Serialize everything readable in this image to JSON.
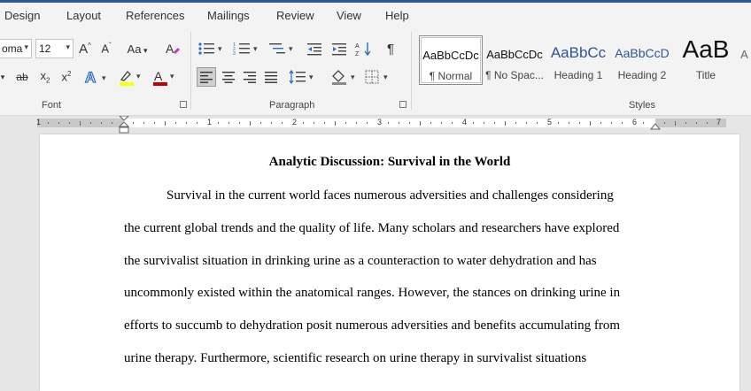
{
  "tabs": [
    "Design",
    "Layout",
    "References",
    "Mailings",
    "Review",
    "View",
    "Help"
  ],
  "font": {
    "name_value": "oma",
    "size_value": "12",
    "group_label": "Font",
    "highlight_color": "#ffff00",
    "font_color": "#c00000"
  },
  "paragraph": {
    "group_label": "Paragraph"
  },
  "styles": {
    "group_label": "Styles",
    "items": [
      {
        "sample": "AaBbCcDc",
        "name": "¶ Normal"
      },
      {
        "sample": "AaBbCcDc",
        "name": "¶ No Spac..."
      },
      {
        "sample": "AaBbCc",
        "name": "Heading 1"
      },
      {
        "sample": "AaBbCcD",
        "name": "Heading 2"
      },
      {
        "sample": "AaB",
        "name": "Title"
      },
      {
        "sample": "A",
        "name": ""
      }
    ]
  },
  "ruler": {
    "numbers": [
      "1",
      "1",
      "2",
      "3",
      "4",
      "5",
      "6",
      "7"
    ]
  },
  "document": {
    "title": "Analytic Discussion: Survival in the World",
    "lines": [
      "Survival in the current world faces numerous adversities and challenges considering",
      "the current global trends and the quality of life. Many scholars and researchers have explored",
      "the survivalist situation in drinking urine as a counteraction to water dehydration and has",
      "uncommonly existed within the anatomical ranges. However, the stances on drinking urine in",
      "efforts to succumb to dehydration posit numerous adversities and benefits accumulating from",
      "urine therapy. Furthermore, scientific research on urine therapy in survivalist situations"
    ]
  },
  "colors": {
    "accent": "#2b579a"
  }
}
